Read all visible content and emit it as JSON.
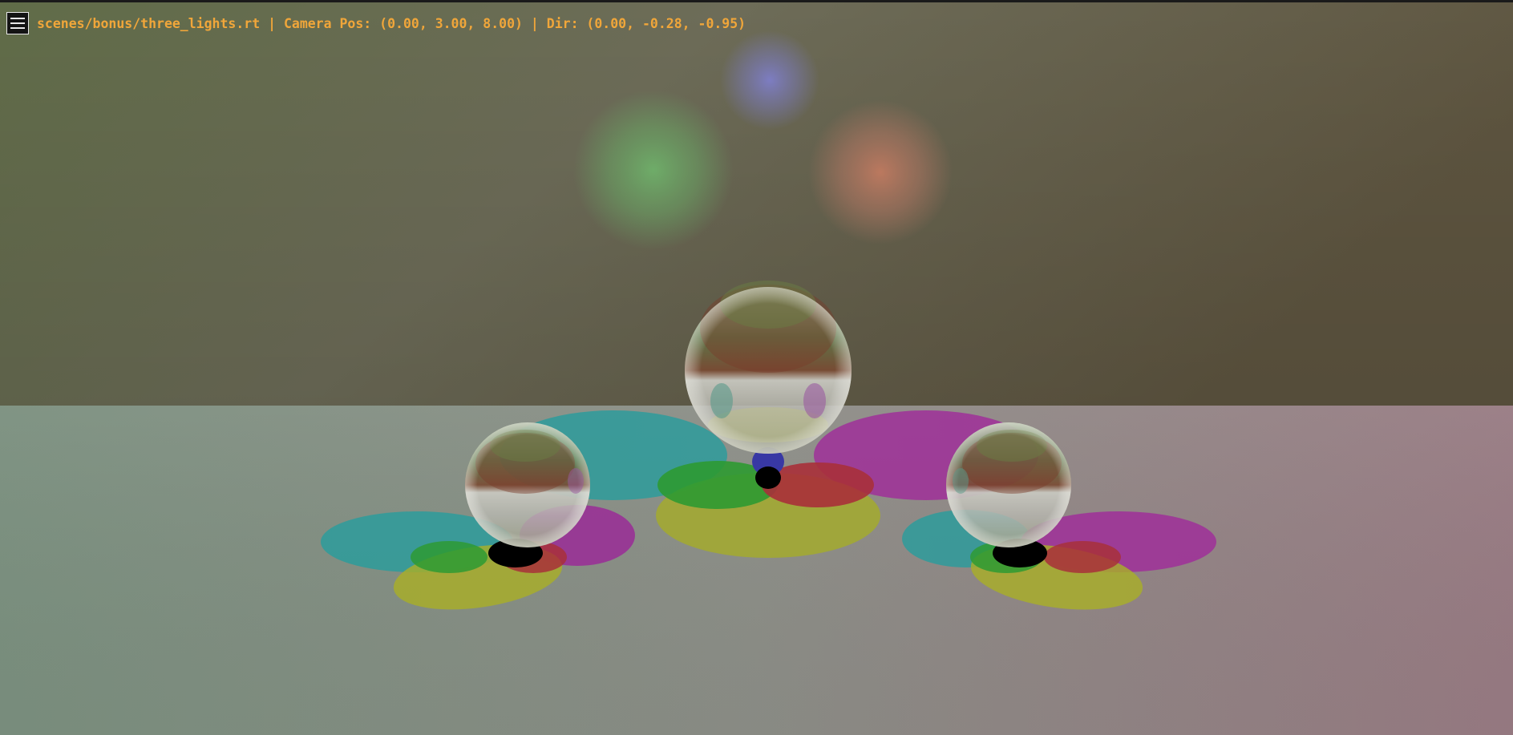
{
  "window": {
    "scene_path": "scenes/bonus/three_lights.rt",
    "camera_label": "Camera Pos:",
    "camera_pos": "(0.00, 3.00, 8.00)",
    "dir_label": "Dir:",
    "dir": "(0.00, -0.28, -0.95)",
    "separator": "|"
  },
  "hud": {
    "menu_icon": "hamburger-menu-icon",
    "text": "scenes/bonus/three_lights.rt | Camera Pos: (0.00, 3.00, 8.00) | Dir: (0.00, -0.28, -0.95)",
    "text_color": "#f0a63a"
  },
  "scene": {
    "light_colors": [
      "#6fa86a",
      "#7f7fc0",
      "#b87a62"
    ],
    "shadow_colors": {
      "cyan": "#2a9a9a",
      "magenta": "#9a2f96",
      "yellow": "#9aa22a",
      "green": "#2f9a33",
      "red": "#a22f38",
      "blue": "#3a3aa8"
    },
    "background_colors": [
      "#5c6a48",
      "#6a6450",
      "#5f5540"
    ],
    "floor_colors": [
      "#7a8c80",
      "#8a8a86",
      "#957a80"
    ]
  }
}
